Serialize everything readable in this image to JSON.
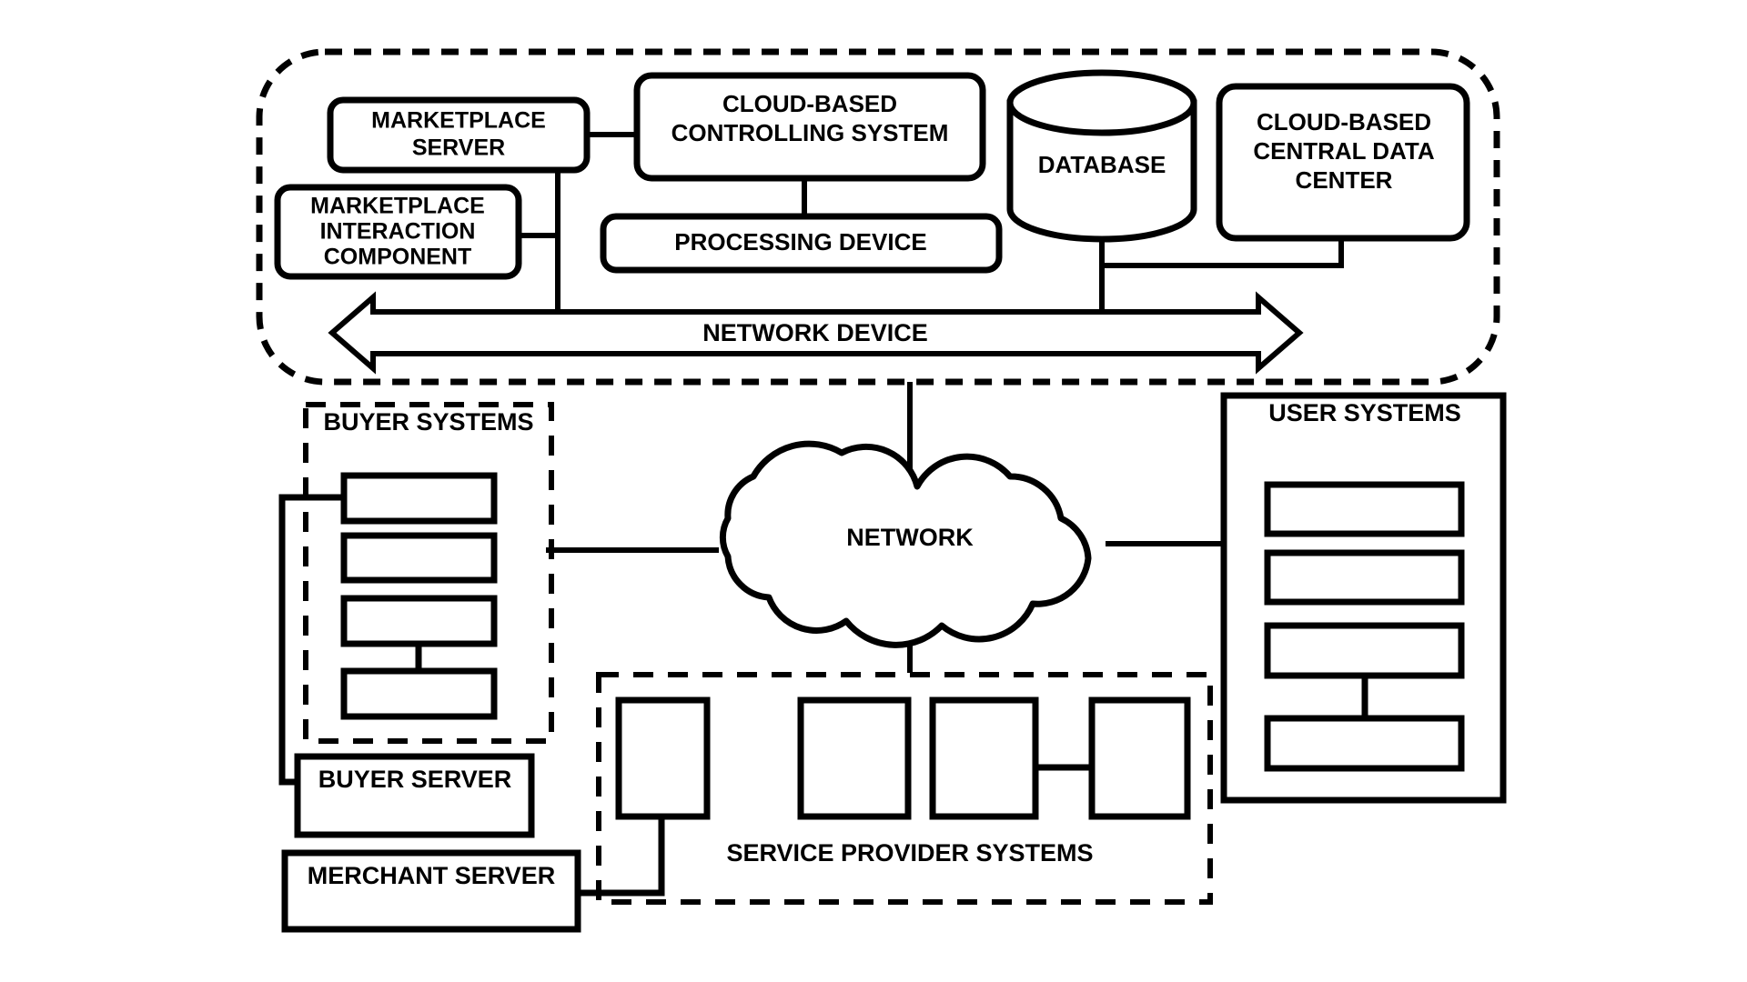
{
  "figure": {
    "type": "patent-block-diagram",
    "background_color": "#FFFFFF",
    "stroke_color": "#000000"
  },
  "cloud_group": {
    "container_style": "dashed-rounded-boundary",
    "nodes": {
      "marketplace_server": "MARKETPLACE\nSERVER",
      "marketplace_server_line1": "MARKETPLACE",
      "marketplace_server_line2": "SERVER",
      "marketplace_interaction_component_line1": "MARKETPLACE",
      "marketplace_interaction_component_line2": "INTERACTION",
      "marketplace_interaction_component_line3": "COMPONENT",
      "cloud_based_controlling_system_line1": "CLOUD-BASED",
      "cloud_based_controlling_system_line2": "CONTROLLING SYSTEM",
      "processing_device": "PROCESSING DEVICE",
      "database": "DATABASE",
      "cloud_based_central_data_center_line1": "CLOUD-BASED",
      "cloud_based_central_data_center_line2": "CENTRAL DATA",
      "cloud_based_central_data_center_line3": "CENTER",
      "network_device": "NETWORK DEVICE"
    }
  },
  "buyer_group": {
    "title": "BUYER SYSTEMS",
    "container_style": "dashed-rect",
    "inner_boxes": 4,
    "buyer_server": "BUYER SERVER",
    "merchant_server": "MERCHANT SERVER"
  },
  "network_cloud": {
    "label": "NETWORK",
    "shape": "cloud"
  },
  "user_group": {
    "title": "USER SYSTEMS",
    "container_style": "solid-rect",
    "inner_boxes": 4
  },
  "service_provider_group": {
    "title": "SERVICE PROVIDER SYSTEMS",
    "container_style": "dashed-rect",
    "inner_boxes": 4
  }
}
